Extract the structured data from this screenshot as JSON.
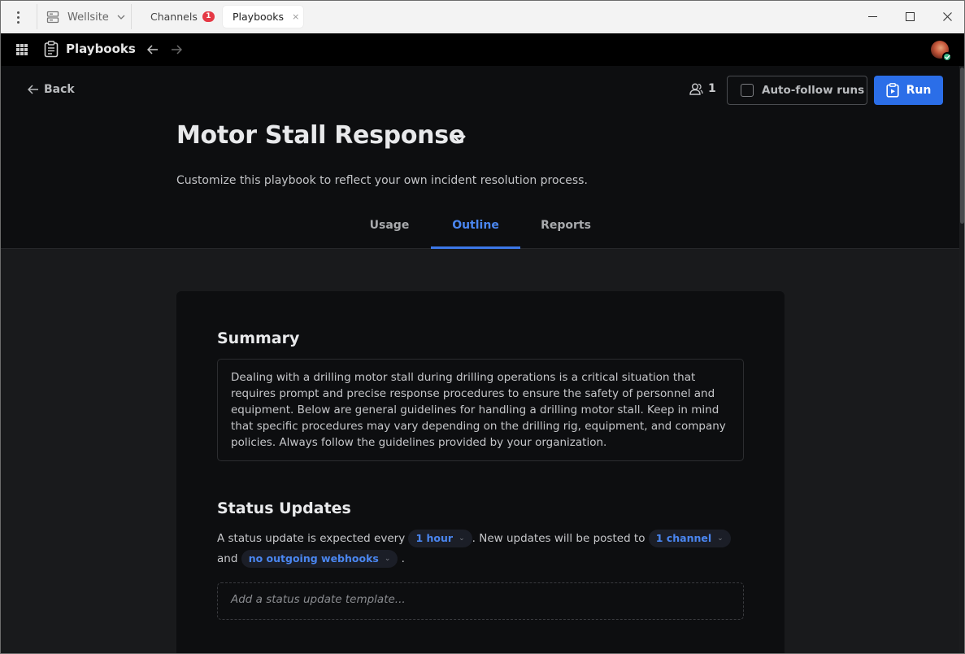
{
  "titlebar": {
    "server_name": "Wellsite",
    "tabs": [
      {
        "label": "Channels",
        "badge": "1"
      },
      {
        "label": "Playbooks",
        "close": "×"
      }
    ]
  },
  "appbar": {
    "product_name": "Playbooks"
  },
  "header": {
    "back_label": "Back",
    "participants_count": "1",
    "auto_follow_label": "Auto-follow runs",
    "run_label": "Run",
    "title": "Motor Stall Response",
    "subtitle": "Customize this playbook to reflect your own incident resolution process.",
    "tabs": [
      "Usage",
      "Outline",
      "Reports"
    ],
    "active_tab": "Outline"
  },
  "summary": {
    "heading": "Summary",
    "text": "Dealing with a drilling motor stall during drilling operations is a critical situation that requires prompt and precise response procedures to ensure the safety of personnel and equipment. Below are general guidelines for handling a drilling motor stall. Keep in mind that specific procedures may vary depending on the drilling rig, equipment, and company policies. Always follow the guidelines provided by your organization."
  },
  "status_updates": {
    "heading": "Status Updates",
    "text_1": "A status update is expected every",
    "interval": "1 hour",
    "text_2": ". New updates will be posted to",
    "channels": "1 channel",
    "text_3": "and",
    "webhooks": "no outgoing webhooks",
    "text_4": ".",
    "template_placeholder": "Add a status update template..."
  },
  "colors": {
    "accent": "#2b6ee8",
    "active_tab": "#4a86f0",
    "online": "#3db887",
    "badge": "#e53945"
  },
  "icons": [
    "kebab-icon",
    "server-icon",
    "chevron-down-icon",
    "minimize-icon",
    "maximize-icon",
    "close-icon",
    "app-grid-icon",
    "playbook-icon",
    "arrow-left-icon",
    "arrow-right-icon",
    "participants-icon",
    "run-icon"
  ]
}
